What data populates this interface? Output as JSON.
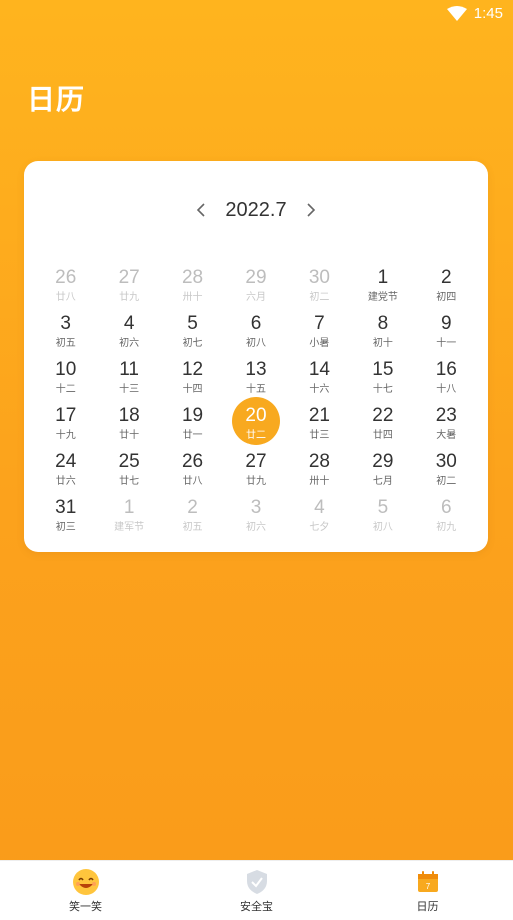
{
  "status": {
    "time": "1:45"
  },
  "page": {
    "title": "日历"
  },
  "calendar": {
    "month": "2022.7",
    "days": [
      {
        "num": "26",
        "lunar": "廿八",
        "other": true
      },
      {
        "num": "27",
        "lunar": "廿九",
        "other": true
      },
      {
        "num": "28",
        "lunar": "卅十",
        "other": true
      },
      {
        "num": "29",
        "lunar": "六月",
        "other": true
      },
      {
        "num": "30",
        "lunar": "初二",
        "other": true
      },
      {
        "num": "1",
        "lunar": "建党节",
        "other": false
      },
      {
        "num": "2",
        "lunar": "初四",
        "other": false
      },
      {
        "num": "3",
        "lunar": "初五",
        "other": false
      },
      {
        "num": "4",
        "lunar": "初六",
        "other": false
      },
      {
        "num": "5",
        "lunar": "初七",
        "other": false
      },
      {
        "num": "6",
        "lunar": "初八",
        "other": false
      },
      {
        "num": "7",
        "lunar": "小暑",
        "other": false
      },
      {
        "num": "8",
        "lunar": "初十",
        "other": false
      },
      {
        "num": "9",
        "lunar": "十一",
        "other": false
      },
      {
        "num": "10",
        "lunar": "十二",
        "other": false
      },
      {
        "num": "11",
        "lunar": "十三",
        "other": false
      },
      {
        "num": "12",
        "lunar": "十四",
        "other": false
      },
      {
        "num": "13",
        "lunar": "十五",
        "other": false
      },
      {
        "num": "14",
        "lunar": "十六",
        "other": false
      },
      {
        "num": "15",
        "lunar": "十七",
        "other": false
      },
      {
        "num": "16",
        "lunar": "十八",
        "other": false
      },
      {
        "num": "17",
        "lunar": "十九",
        "other": false
      },
      {
        "num": "18",
        "lunar": "廿十",
        "other": false
      },
      {
        "num": "19",
        "lunar": "廿一",
        "other": false
      },
      {
        "num": "20",
        "lunar": "廿二",
        "other": false,
        "selected": true
      },
      {
        "num": "21",
        "lunar": "廿三",
        "other": false
      },
      {
        "num": "22",
        "lunar": "廿四",
        "other": false
      },
      {
        "num": "23",
        "lunar": "大暑",
        "other": false
      },
      {
        "num": "24",
        "lunar": "廿六",
        "other": false
      },
      {
        "num": "25",
        "lunar": "廿七",
        "other": false
      },
      {
        "num": "26",
        "lunar": "廿八",
        "other": false
      },
      {
        "num": "27",
        "lunar": "廿九",
        "other": false
      },
      {
        "num": "28",
        "lunar": "卅十",
        "other": false
      },
      {
        "num": "29",
        "lunar": "七月",
        "other": false
      },
      {
        "num": "30",
        "lunar": "初二",
        "other": false
      },
      {
        "num": "31",
        "lunar": "初三",
        "other": false
      },
      {
        "num": "1",
        "lunar": "建军节",
        "other": true
      },
      {
        "num": "2",
        "lunar": "初五",
        "other": true
      },
      {
        "num": "3",
        "lunar": "初六",
        "other": true
      },
      {
        "num": "4",
        "lunar": "七夕",
        "other": true
      },
      {
        "num": "5",
        "lunar": "初八",
        "other": true
      },
      {
        "num": "6",
        "lunar": "初九",
        "other": true
      }
    ]
  },
  "nav": {
    "items": [
      {
        "label": "笑一笑",
        "icon": "smiley-icon"
      },
      {
        "label": "安全宝",
        "icon": "shield-icon"
      },
      {
        "label": "日历",
        "icon": "calendar-icon",
        "active": true
      }
    ],
    "calendar_icon_day": "7"
  },
  "colors": {
    "accent": "#f8a91f",
    "bg_top": "#ffb41e",
    "bg_bottom": "#f99b1a"
  }
}
